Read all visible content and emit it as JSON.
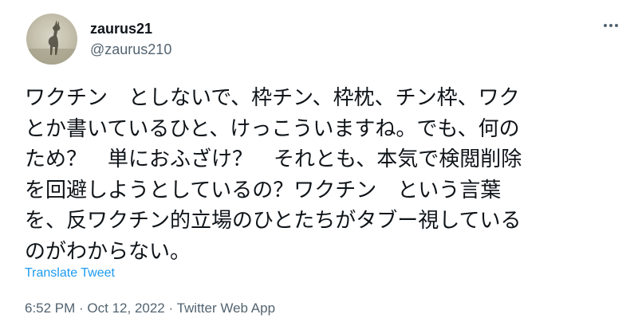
{
  "user": {
    "display_name": "zaurus21",
    "handle": "@zaurus210",
    "avatar_icon": "deer-avatar-icon"
  },
  "more_icon": "more-options-icon",
  "tweet": {
    "lines": [
      "ワクチン　としないで、枠チン、枠枕、チン枠、ワク",
      "とか書いているひと、けっこういますね。でも、何の",
      "ため？　単におふざけ？　それとも、本気で検閲削除",
      "を回避しようとしているの？ワクチン　という言葉",
      "を、反ワクチン的立場のひとたちがタブー視している",
      "のがわからない。"
    ]
  },
  "translate_label": "Translate Tweet",
  "meta": {
    "time": "6:52 PM",
    "separator": " · ",
    "date": "Oct 12, 2022",
    "source": "Twitter Web App"
  },
  "colors": {
    "text": "#0f1419",
    "secondary": "#536471",
    "link": "#1d9bf0",
    "background": "#ffffff"
  }
}
